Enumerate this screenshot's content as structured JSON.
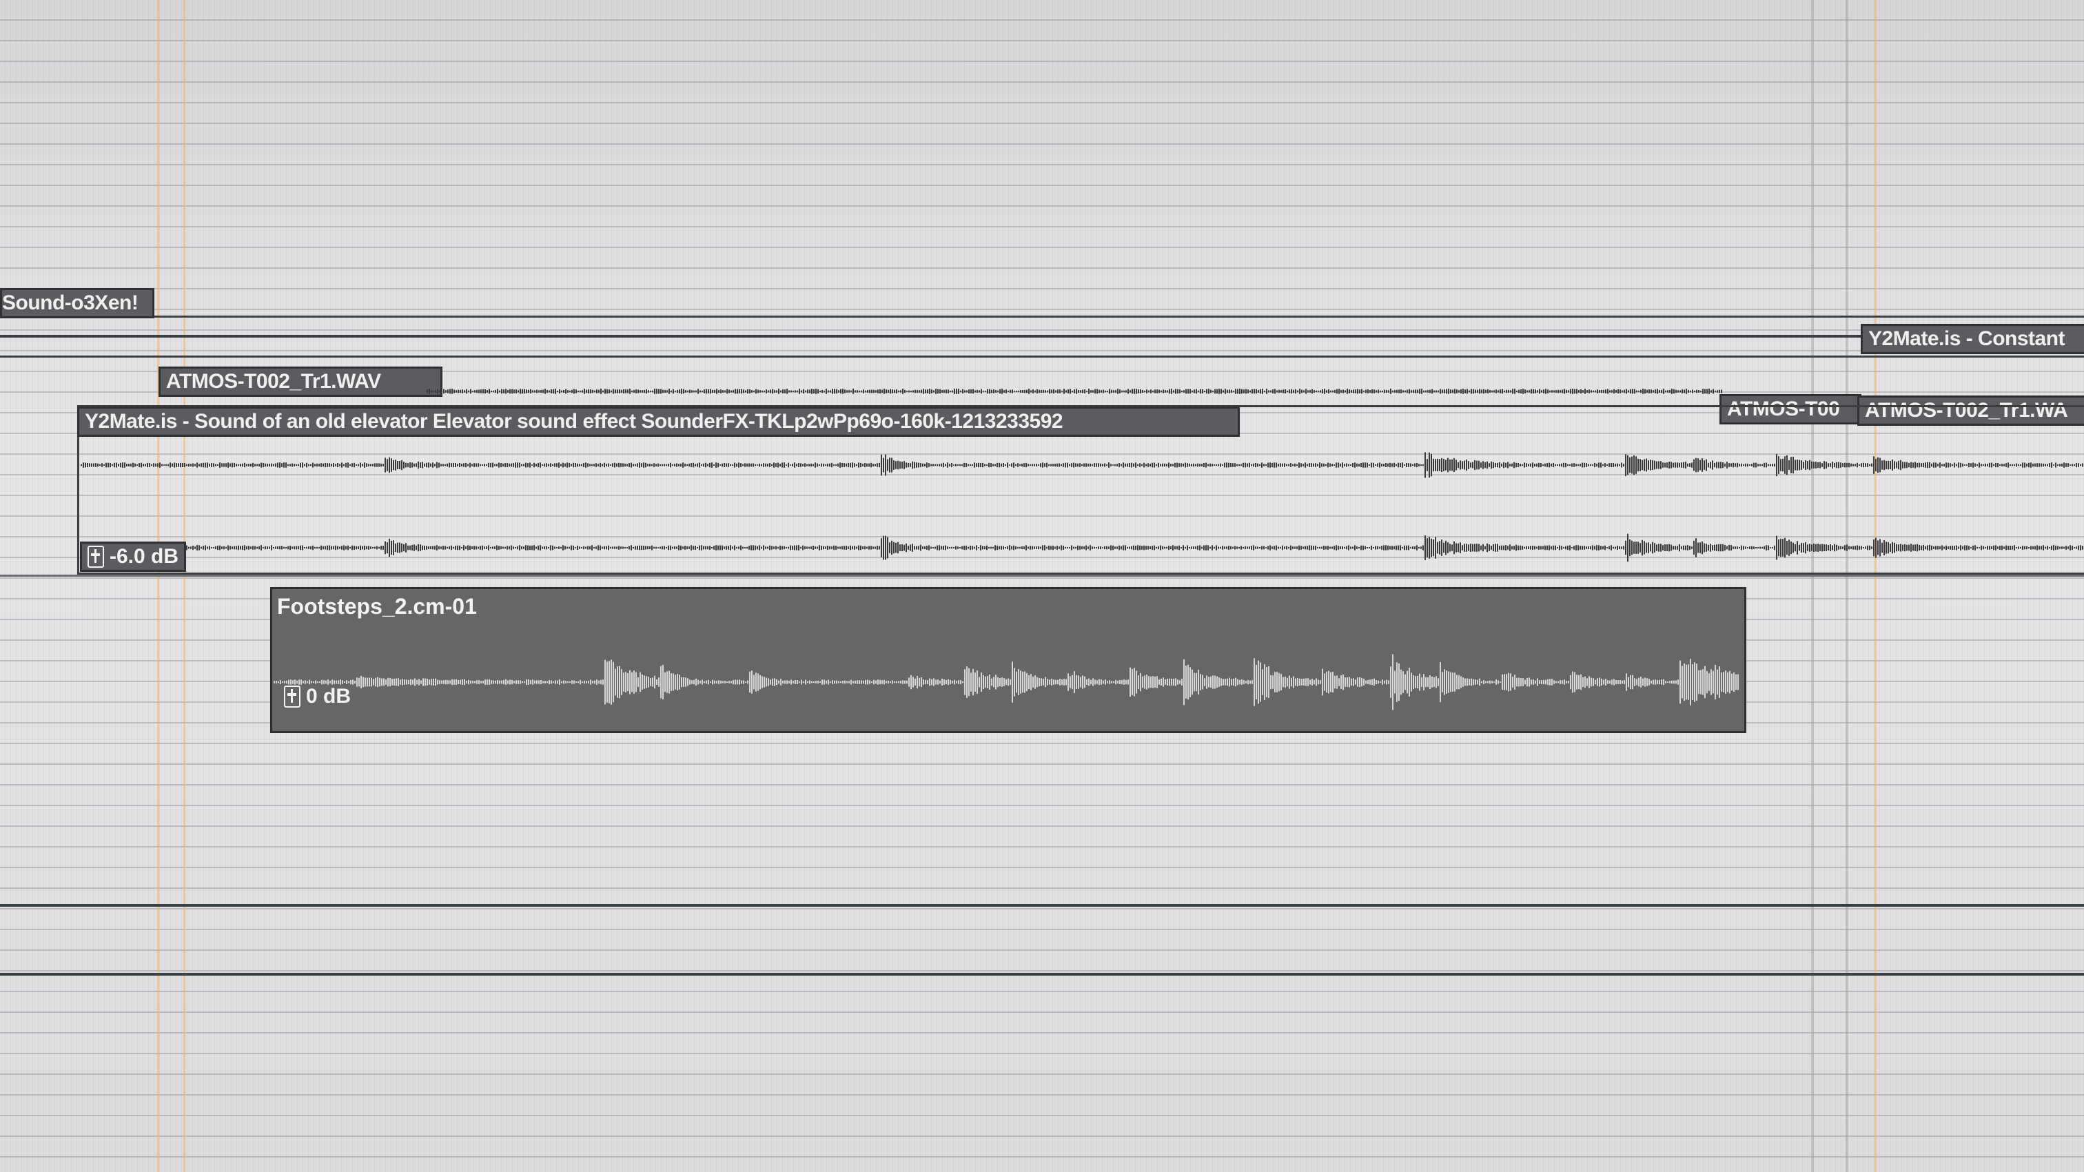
{
  "colors": {
    "background": "#e2e2e4",
    "clip_label_bg": "#5c5c60",
    "clip_body_dark": "#666669",
    "waveform_dark": "#3a3a3d",
    "waveform_light": "#d6d6d8",
    "playhead_marker": "#f0b45a"
  },
  "clips": {
    "top_left": {
      "label": "Sound-o3Xen!"
    },
    "top_right": {
      "label": "Y2Mate.is - Constant"
    },
    "atmos_main": {
      "label": "ATMOS-T002_Tr1.WAV"
    },
    "atmos_right_a": {
      "label": "ATMOS-T00"
    },
    "atmos_right_b": {
      "label": "ATMOS-T002_Tr1.WA"
    },
    "elevator": {
      "label": "Y2Mate.is - Sound of an old elevator  Elevator sound effect  SounderFX-TKLp2wPp69o-160k-1213233592",
      "gain": "-6.0 dB"
    },
    "footsteps": {
      "label": "Footsteps_2.cm-01",
      "gain": "0 dB"
    }
  },
  "icons": {
    "gain": "clip-gain-icon"
  }
}
